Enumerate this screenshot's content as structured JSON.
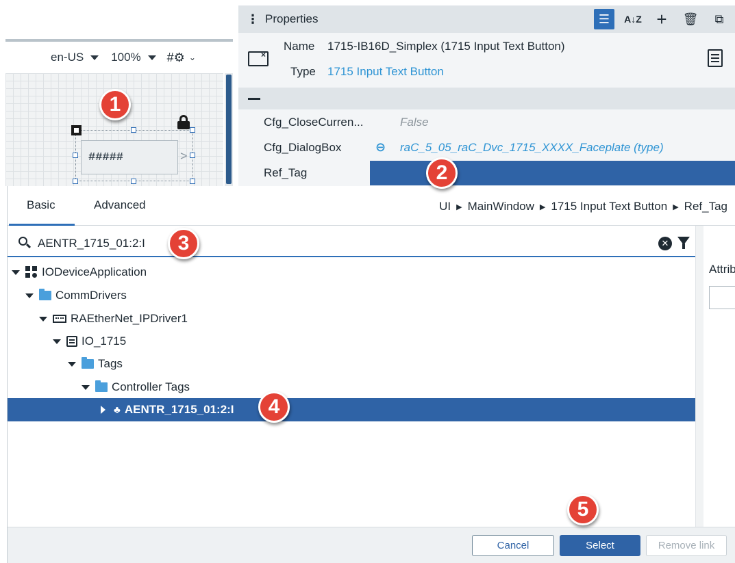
{
  "canvas": {
    "toolbar": {
      "locale": "en-US",
      "zoom": "100%",
      "grid_icon": "grid-settings-icon"
    },
    "widget": {
      "placeholder_text": "#####"
    }
  },
  "properties": {
    "title": "Properties",
    "header_icons": [
      "sort-categorized-icon",
      "sort-az-icon",
      "add-icon",
      "delete-icon",
      "popout-icon"
    ],
    "name_label": "Name",
    "name_value": "1715-IB16D_Simplex (1715 Input Text Button)",
    "type_label": "Type",
    "type_value": "1715 Input Text Button",
    "rows": [
      {
        "label": "Cfg_CloseCurren...",
        "value": "False"
      },
      {
        "label": "Cfg_DialogBox",
        "value": "raC_5_05_raC_Dvc_1715_XXXX_Faceplate (type)"
      },
      {
        "label": "Ref_Tag",
        "value": ""
      }
    ]
  },
  "dialog": {
    "tabs": [
      "Basic",
      "Advanced"
    ],
    "breadcrumb": [
      "UI",
      "MainWindow",
      "1715 Input Text Button",
      "Ref_Tag"
    ],
    "search_value": "AENTR_1715_01:2:I",
    "tree": [
      {
        "label": "IODeviceApplication"
      },
      {
        "label": "CommDrivers"
      },
      {
        "label": "RAEtherNet_IPDriver1"
      },
      {
        "label": "IO_1715"
      },
      {
        "label": "Tags"
      },
      {
        "label": "Controller Tags"
      },
      {
        "label": "AENTR_1715_01:2:I"
      }
    ],
    "attribute_label": "Attribute",
    "buttons": {
      "cancel": "Cancel",
      "select": "Select",
      "remove": "Remove link"
    }
  },
  "callouts": [
    "1",
    "2",
    "3",
    "4",
    "5"
  ],
  "colors": {
    "accent": "#2e6fb8",
    "selection": "#2f63a6",
    "link": "#2e94d4",
    "callout": "#e44236"
  }
}
